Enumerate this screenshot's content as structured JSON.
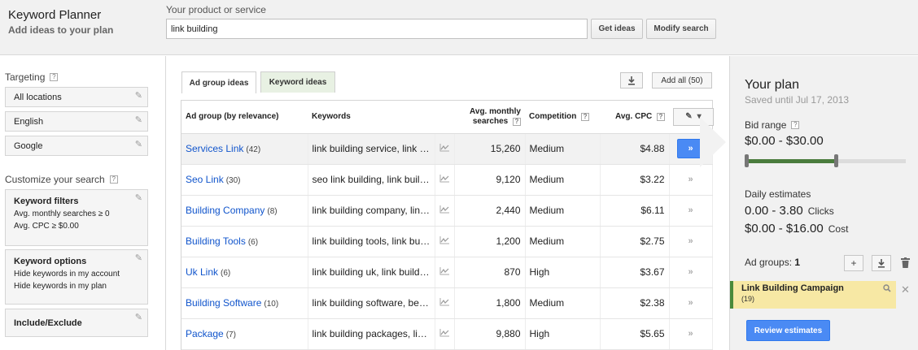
{
  "header": {
    "app_title": "Keyword Planner",
    "app_subtitle": "Add ideas to your plan",
    "product_label": "Your product or service",
    "product_value": "link building",
    "get_ideas_label": "Get ideas",
    "modify_search_label": "Modify search"
  },
  "sidebar": {
    "targeting_label": "Targeting",
    "help_glyph": "?",
    "targeting": [
      "All locations",
      "English",
      "Google"
    ],
    "customize_label": "Customize your search",
    "keyword_filters": {
      "title": "Keyword filters",
      "lines": [
        "Avg. monthly searches ≥ 0",
        "Avg. CPC ≥ $0.00"
      ]
    },
    "keyword_options": {
      "title": "Keyword options",
      "lines": [
        "Hide keywords in my account",
        "Hide keywords in my plan"
      ]
    },
    "include_exclude": "Include/Exclude"
  },
  "main": {
    "tabs": [
      {
        "label": "Ad group ideas",
        "active": true
      },
      {
        "label": "Keyword ideas",
        "active": false
      }
    ],
    "add_all_label": "Add all (50)",
    "columns": {
      "adgroup": "Ad group (by relevance)",
      "keywords": "Keywords",
      "searches": "Avg. monthly searches",
      "competition": "Competition",
      "cpc": "Avg. CPC"
    },
    "rows": [
      {
        "name": "Services Link",
        "count": "(42)",
        "keywords": "link building service, link building services",
        "searches": "15,260",
        "competition": "Medium",
        "cpc": "$4.88",
        "highlighted": true
      },
      {
        "name": "Seo Link",
        "count": "(30)",
        "keywords": "seo link building, link building seo",
        "searches": "9,120",
        "competition": "Medium",
        "cpc": "$3.22",
        "highlighted": false
      },
      {
        "name": "Building Company",
        "count": "(8)",
        "keywords": "link building company, link building companies",
        "searches": "2,440",
        "competition": "Medium",
        "cpc": "$6.11",
        "highlighted": false
      },
      {
        "name": "Building Tools",
        "count": "(6)",
        "keywords": "link building tools, link building tool",
        "searches": "1,200",
        "competition": "Medium",
        "cpc": "$2.75",
        "highlighted": false
      },
      {
        "name": "Uk Link",
        "count": "(6)",
        "keywords": "link building uk, link building services uk",
        "searches": "870",
        "competition": "High",
        "cpc": "$3.67",
        "highlighted": false
      },
      {
        "name": "Building Software",
        "count": "(10)",
        "keywords": "link building software, best link building software",
        "searches": "1,800",
        "competition": "Medium",
        "cpc": "$2.38",
        "highlighted": false
      },
      {
        "name": "Package",
        "count": "(7)",
        "keywords": "link building packages, link building package",
        "searches": "9,880",
        "competition": "High",
        "cpc": "$5.65",
        "highlighted": false
      }
    ]
  },
  "plan": {
    "title": "Your plan",
    "saved": "Saved until Jul 17, 2013",
    "bid_label": "Bid range",
    "bid_value": "$0.00 - $30.00",
    "bid_range_fraction": [
      0.0,
      0.56
    ],
    "daily_label": "Daily estimates",
    "clicks_value": "0.00 - 3.80",
    "clicks_unit": "Clicks",
    "cost_value": "$0.00 - $16.00",
    "cost_unit": "Cost",
    "adgroups_label": "Ad groups:",
    "adgroups_count": "1",
    "campaign_name": "Link Building Campaign",
    "campaign_count": "(19)",
    "review_label": "Review estimates"
  },
  "colors": {
    "link_blue": "#1155cc",
    "primary_button": "#4a8af4",
    "slider_fill": "#4a7c3d",
    "campaign_bg": "#f7e8a4"
  }
}
